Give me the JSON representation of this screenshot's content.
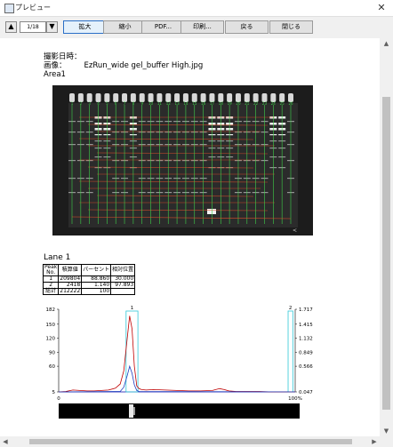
{
  "window": {
    "title": "プレビュー",
    "close_glyph": "✕"
  },
  "toolbar": {
    "prev_glyph": "▲",
    "next_glyph": "▼",
    "page_indicator": "1/18",
    "buttons": {
      "zoom_in": "拡大",
      "zoom_out": "縮小",
      "pdf": "PDF...",
      "print": "印刷...",
      "back": "戻る",
      "close": "閉じる"
    }
  },
  "document": {
    "capture_label": "撮影日時：",
    "image_label": "画像：",
    "image_name": "EzRun_wide gel_buffer High.jpg",
    "area_label": "Area1",
    "lane_title": "Lane 1",
    "gel_marker": "<",
    "gel_lane_tags": [
      "1",
      "2",
      "3",
      "4",
      "5",
      "6",
      "7",
      "8",
      "9",
      "10",
      "11",
      "12",
      "13",
      "14",
      "15",
      "16",
      "17",
      "18",
      "19",
      "20",
      "21",
      "22",
      "23",
      "24",
      "25",
      "26"
    ],
    "peak_table": {
      "headers": [
        "Peak No.",
        "積算値",
        "パーセント",
        "相対位置"
      ],
      "rows": [
        [
          "1",
          "209804",
          "88.860",
          "30.000"
        ],
        [
          "2",
          "2418",
          "1.140",
          "97.893"
        ],
        [
          "総計",
          "212222",
          "100",
          ""
        ]
      ]
    }
  },
  "chart_data": {
    "type": "line",
    "x_ticks": [
      "0",
      "100%"
    ],
    "y_ticks_left": [
      "182",
      "150",
      "120",
      "90",
      "60",
      "5"
    ],
    "y_ticks_right": [
      "1.717",
      "1.415",
      "1.132",
      "0.849",
      "0.566",
      "0.047"
    ],
    "ylim_left": [
      5,
      182
    ],
    "xlim": [
      0,
      100
    ],
    "peak_labels": [
      "1",
      "2"
    ],
    "peak_boxes": [
      {
        "label": "1",
        "x_from": 28.5,
        "x_to": 33.5
      },
      {
        "label": "2",
        "x_from": 97,
        "x_to": 99
      }
    ],
    "series": [
      {
        "color": "#c00000",
        "x": [
          0,
          3,
          6,
          9,
          12,
          15,
          18,
          21,
          24,
          26,
          27.5,
          29,
          30,
          31,
          32,
          33,
          34,
          35,
          37,
          40,
          45,
          50,
          55,
          60,
          65,
          68,
          70,
          72,
          75,
          80,
          85,
          90,
          95,
          98,
          100
        ],
        "y": [
          5,
          6,
          9,
          8,
          7,
          7,
          8,
          9,
          13,
          22,
          50,
          120,
          168,
          140,
          60,
          18,
          12,
          10,
          9,
          10,
          9,
          8,
          7,
          7,
          8,
          12,
          10,
          7,
          6,
          6,
          6,
          5,
          5,
          5,
          5
        ]
      },
      {
        "color": "#1f3fbf",
        "x": [
          0,
          26,
          27.5,
          29,
          30,
          31,
          32,
          33,
          34,
          100
        ],
        "y": [
          5,
          6,
          15,
          40,
          60,
          45,
          20,
          8,
          6,
          5
        ]
      }
    ]
  },
  "colors": {
    "lane_line": "#3fd24a",
    "band_mark": "#e0502a",
    "peak_box": "#30c8d8",
    "chart_axis": "#4040c0"
  }
}
